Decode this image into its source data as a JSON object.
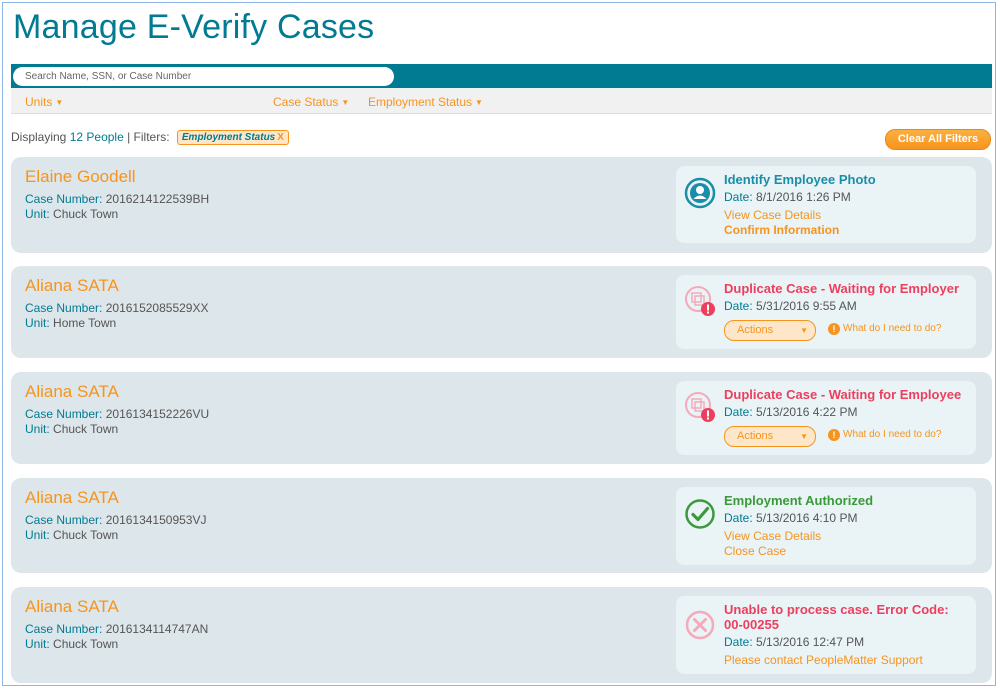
{
  "page": {
    "title": "Manage E-Verify Cases"
  },
  "search": {
    "placeholder": "Search Name, SSN, or Case Number"
  },
  "filters": {
    "units_label": "Units",
    "case_status_label": "Case Status",
    "employment_status_label": "Employment Status"
  },
  "summary": {
    "prefix": "Displaying",
    "count": "12 People",
    "separator": "| Filters:",
    "chip_label": "Employment Status",
    "chip_remove": "X",
    "clear_label": "Clear All Filters"
  },
  "labels": {
    "case_number": "Case Number:",
    "unit": "Unit:",
    "date": "Date:",
    "actions": "Actions",
    "help": "What do I need to do?"
  },
  "colors": {
    "brand": "#007b92",
    "accent": "#f7941d",
    "alert": "#ec3f5e",
    "ok": "#3a9a3a"
  },
  "cases": [
    {
      "name": "Elaine Goodell",
      "case_number": "2016214122539BH",
      "unit": "Chuck Town",
      "status_icon": "user-photo-icon",
      "status_title": "Identify Employee Photo",
      "date": "8/1/2016 1:26 PM",
      "link1": "View Case Details",
      "link2": "Confirm Information"
    },
    {
      "name": "Aliana SATA",
      "case_number": "2016152085529XX",
      "unit": "Home Town",
      "status_icon": "duplicate-alert-icon",
      "status_title": "Duplicate Case - Waiting for Employer",
      "date": "5/31/2016 9:55 AM"
    },
    {
      "name": "Aliana SATA",
      "case_number": "2016134152226VU",
      "unit": "Chuck Town",
      "status_icon": "duplicate-alert-icon",
      "status_title": "Duplicate Case - Waiting for Employee",
      "date": "5/13/2016 4:22 PM"
    },
    {
      "name": "Aliana SATA",
      "case_number": "2016134150953VJ",
      "unit": "Chuck Town",
      "status_icon": "check-circle-icon",
      "status_title": "Employment Authorized",
      "date": "5/13/2016 4:10 PM",
      "link1": "View Case Details",
      "link2": "Close Case"
    },
    {
      "name": "Aliana SATA",
      "case_number": "2016134114747AN",
      "unit": "Chuck Town",
      "status_icon": "error-x-icon",
      "status_title": "Unable to process case. Error Code: 00-00255",
      "date": "5/13/2016 12:47 PM",
      "link1": "Please contact PeopleMatter Support"
    }
  ]
}
